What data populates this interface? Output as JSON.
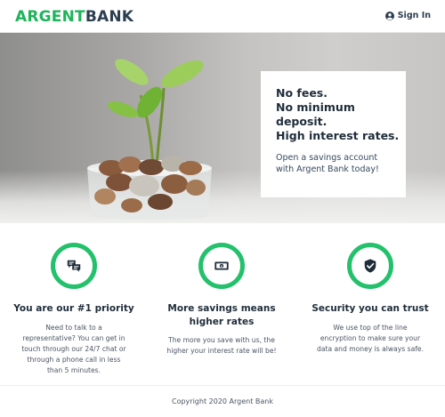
{
  "header": {
    "brand_part1": "ARGENT",
    "brand_part2": "BANK",
    "signin_label": "Sign In",
    "signin_icon": "user-circle-icon"
  },
  "hero": {
    "headline_lines": [
      "No fees.",
      "No minimum",
      "deposit.",
      "High interest rates."
    ],
    "subtext_lines": [
      "Open a savings account",
      "with Argent Bank today!"
    ]
  },
  "features": [
    {
      "icon": "chat-icon",
      "title_lines": [
        "You are our #1 priority"
      ],
      "text_lines": [
        "Need to talk to a",
        "representative? You can get in",
        "touch through our 24/7 chat or",
        "through a phone call in less",
        "than 5 minutes."
      ]
    },
    {
      "icon": "money-icon",
      "title_lines": [
        "More savings means",
        "higher rates"
      ],
      "text_lines": [
        "The more you save with us, the",
        "higher your interest rate will be!"
      ]
    },
    {
      "icon": "shield-icon",
      "title_lines": [
        "Security you can trust"
      ],
      "text_lines": [
        "We use top of the line",
        "encryption to make sure your",
        "data and money is always safe."
      ]
    }
  ],
  "footer": {
    "copyright": "Copyright 2020 Argent Bank"
  },
  "colors": {
    "accent": "#23c16b",
    "brand_green": "#1db45a",
    "text_dark": "#2c3e50"
  }
}
